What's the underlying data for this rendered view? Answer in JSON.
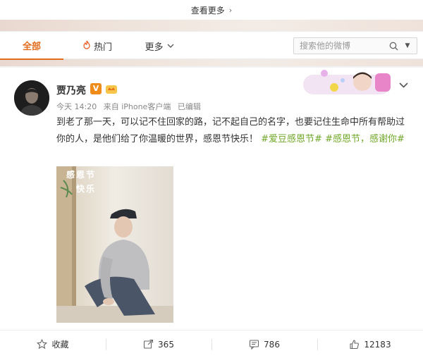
{
  "top": {
    "see_more": "查看更多"
  },
  "tabs": {
    "all": "全部",
    "hot": "热门",
    "more": "更多"
  },
  "search": {
    "placeholder": "搜索他的微博"
  },
  "post": {
    "author": "贾乃亮",
    "verified_badge": "V",
    "time": "今天 14:20",
    "source": "来自 iPhone客户端",
    "edited": "已编辑",
    "text_main": "到老了那一天，可以记不住回家的路，记不起自己的名字，也要记住生命中所有帮助过你的人，是他们给了你温暖的世界，感恩节快乐！",
    "tag1": "#爱豆感恩节#",
    "tag2": "#感恩节，感谢你#",
    "photo_caption_line1": "感恩节",
    "photo_caption_line2": "快乐"
  },
  "actions": {
    "collect": "收藏",
    "repost": "365",
    "comment": "786",
    "like": "12183"
  },
  "colors": {
    "accent": "#e06c1c",
    "tag": "#70a829",
    "badge": "#ef8b1b"
  }
}
